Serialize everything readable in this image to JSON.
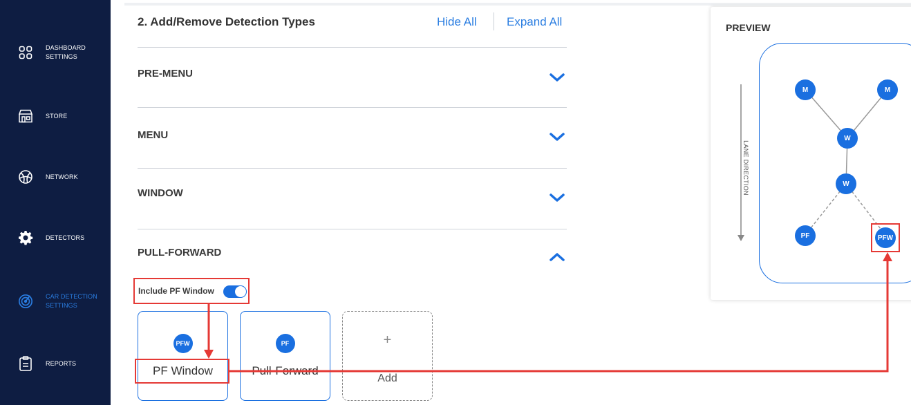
{
  "sidebar": {
    "items": [
      {
        "label": "DASHBOARD\nSETTINGS",
        "icon": "grid-icon"
      },
      {
        "label": "STORE",
        "icon": "store-icon"
      },
      {
        "label": "NETWORK",
        "icon": "network-icon"
      },
      {
        "label": "DETECTORS",
        "icon": "gear-icon"
      },
      {
        "label": "CAR DETECTION\nSETTINGS",
        "icon": "radar-icon",
        "active": true
      },
      {
        "label": "REPORTS",
        "icon": "clipboard-icon"
      }
    ]
  },
  "header": {
    "title": "2. Add/Remove Detection Types",
    "hide_all": "Hide All",
    "expand_all": "Expand All"
  },
  "sections": [
    {
      "label": "PRE-MENU",
      "expanded": false
    },
    {
      "label": "MENU",
      "expanded": false
    },
    {
      "label": "WINDOW",
      "expanded": false
    },
    {
      "label": "PULL-FORWARD",
      "expanded": true
    }
  ],
  "pull_forward": {
    "include_label": "Include PF Window",
    "include_enabled": true,
    "cards": [
      {
        "badge": "PFW",
        "label": "PF Window"
      },
      {
        "badge": "PF",
        "label": "Pull-Forward"
      }
    ],
    "add_plus": "+",
    "add_label": "Add"
  },
  "preview": {
    "title": "PREVIEW",
    "lane_direction": "LANE DIRECTION",
    "nodes": [
      {
        "label": "M"
      },
      {
        "label": "M"
      },
      {
        "label": "W"
      },
      {
        "label": "W"
      },
      {
        "label": "PF"
      },
      {
        "label": "PFW"
      }
    ]
  },
  "colors": {
    "sidebar_bg": "#0e1d42",
    "accent": "#1a6fe0",
    "link": "#2a7de1",
    "highlight": "#e53935"
  }
}
